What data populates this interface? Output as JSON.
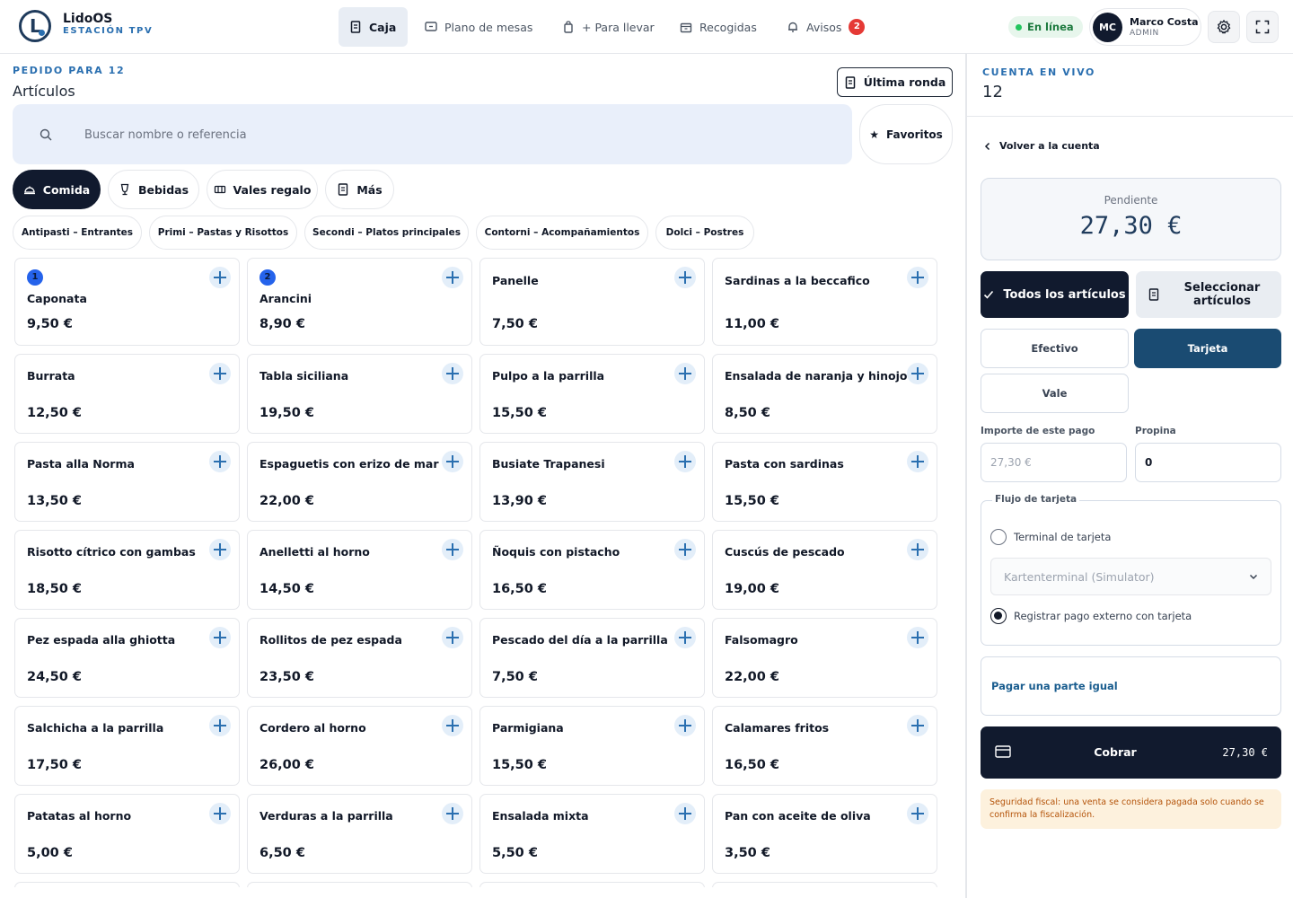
{
  "app": {
    "name": "LidoOS",
    "subtitle": "ESTACIÓN TPV",
    "logo_letter": "L"
  },
  "nav": {
    "items": [
      {
        "label": "Caja",
        "icon": "receipt-icon",
        "active": true
      },
      {
        "label": "Plano de mesas",
        "icon": "table-plan-icon",
        "active": false
      },
      {
        "label": "+ Para llevar",
        "icon": "bag-icon",
        "active": false
      },
      {
        "label": "Recogidas",
        "icon": "box-icon",
        "active": false
      },
      {
        "label": "Avisos",
        "icon": "bell-icon",
        "active": false,
        "badge": "2"
      }
    ]
  },
  "status": {
    "online_label": "En línea"
  },
  "user": {
    "initials": "MC",
    "name": "Marco Costa",
    "role": "ADMIN"
  },
  "order": {
    "eyebrow": "PEDIDO PARA 12",
    "title": "Artículos",
    "last_round_label": "Última ronda",
    "search_placeholder": "Buscar nombre o referencia",
    "search_value": "",
    "favorites_label": "Favoritos"
  },
  "categories": [
    {
      "label": "Comida",
      "icon": "food-icon",
      "active": true
    },
    {
      "label": "Bebidas",
      "icon": "glass-icon",
      "active": false
    },
    {
      "label": "Vales regalo",
      "icon": "ticket-icon",
      "active": false
    },
    {
      "label": "Más",
      "icon": "receipt-icon",
      "active": false
    }
  ],
  "subcategories": [
    "Antipasti – Entrantes",
    "Primi – Pastas y Risottos",
    "Secondi – Platos principales",
    "Contorni – Acompañamientos",
    "Dolci – Postres"
  ],
  "products": [
    {
      "name": "Caponata",
      "price": "9,50 €",
      "count": "1"
    },
    {
      "name": "Arancini",
      "price": "8,90 €",
      "count": "2"
    },
    {
      "name": "Panelle",
      "price": "7,50 €"
    },
    {
      "name": "Sardinas a la beccafico",
      "price": "11,00 €"
    },
    {
      "name": "Burrata",
      "price": "12,50 €"
    },
    {
      "name": "Tabla siciliana",
      "price": "19,50 €"
    },
    {
      "name": "Pulpo a la parrilla",
      "price": "15,50 €"
    },
    {
      "name": "Ensalada de naranja y hinojo",
      "price": "8,50 €"
    },
    {
      "name": "Pasta alla Norma",
      "price": "13,50 €"
    },
    {
      "name": "Espaguetis con erizo de mar",
      "price": "22,00 €"
    },
    {
      "name": "Busiate Trapanesi",
      "price": "13,90 €"
    },
    {
      "name": "Pasta con sardinas",
      "price": "15,50 €"
    },
    {
      "name": "Risotto cítrico con gambas",
      "price": "18,50 €"
    },
    {
      "name": "Anelletti al horno",
      "price": "14,50 €"
    },
    {
      "name": "Ñoquis con pistacho",
      "price": "16,50 €"
    },
    {
      "name": "Cuscús de pescado",
      "price": "19,00 €"
    },
    {
      "name": "Pez espada alla ghiotta",
      "price": "24,50 €"
    },
    {
      "name": "Rollitos de pez espada",
      "price": "23,50 €"
    },
    {
      "name": "Pescado del día a la parrilla",
      "price": "7,50 €"
    },
    {
      "name": "Falsomagro",
      "price": "22,00 €"
    },
    {
      "name": "Salchicha a la parrilla",
      "price": "17,50 €"
    },
    {
      "name": "Cordero al horno",
      "price": "26,00 €"
    },
    {
      "name": "Parmigiana",
      "price": "15,50 €"
    },
    {
      "name": "Calamares fritos",
      "price": "16,50 €"
    },
    {
      "name": "Patatas al horno",
      "price": "5,00 €"
    },
    {
      "name": "Verduras a la parrilla",
      "price": "6,50 €"
    },
    {
      "name": "Ensalada mixta",
      "price": "5,50 €"
    },
    {
      "name": "Pan con aceite de oliva",
      "price": "3,50 €"
    }
  ],
  "account": {
    "eyebrow": "CUENTA EN VIVO",
    "number": "12",
    "back_label": "Volver a la cuenta",
    "pending_label": "Pendiente",
    "pending_amount": "27,30 €",
    "mode_all_label": "Todos los artículos",
    "mode_select_label": "Seleccionar artículos",
    "pay_methods": [
      {
        "label": "Efectivo",
        "active": false
      },
      {
        "label": "Tarjeta",
        "active": true
      },
      {
        "label": "Vale",
        "active": false
      }
    ],
    "amount_label": "Importe de este pago",
    "amount_placeholder": "27,30 €",
    "amount_value": "",
    "tip_label": "Propina",
    "tip_value": "0",
    "card_flow_label": "Flujo de tarjeta",
    "terminal_option_label": "Terminal de tarjeta",
    "terminal_selected": "Kartenterminal (Simulator)",
    "external_option_label": "Registrar pago externo con tarjeta",
    "selected_flow": "external",
    "equal_part_label": "Pagar una parte igual",
    "charge_label": "Cobrar",
    "charge_amount": "27,30 €",
    "fiscal_notice": "Seguridad fiscal: una venta se considera pagada solo cuando se confirma la fiscalización."
  }
}
